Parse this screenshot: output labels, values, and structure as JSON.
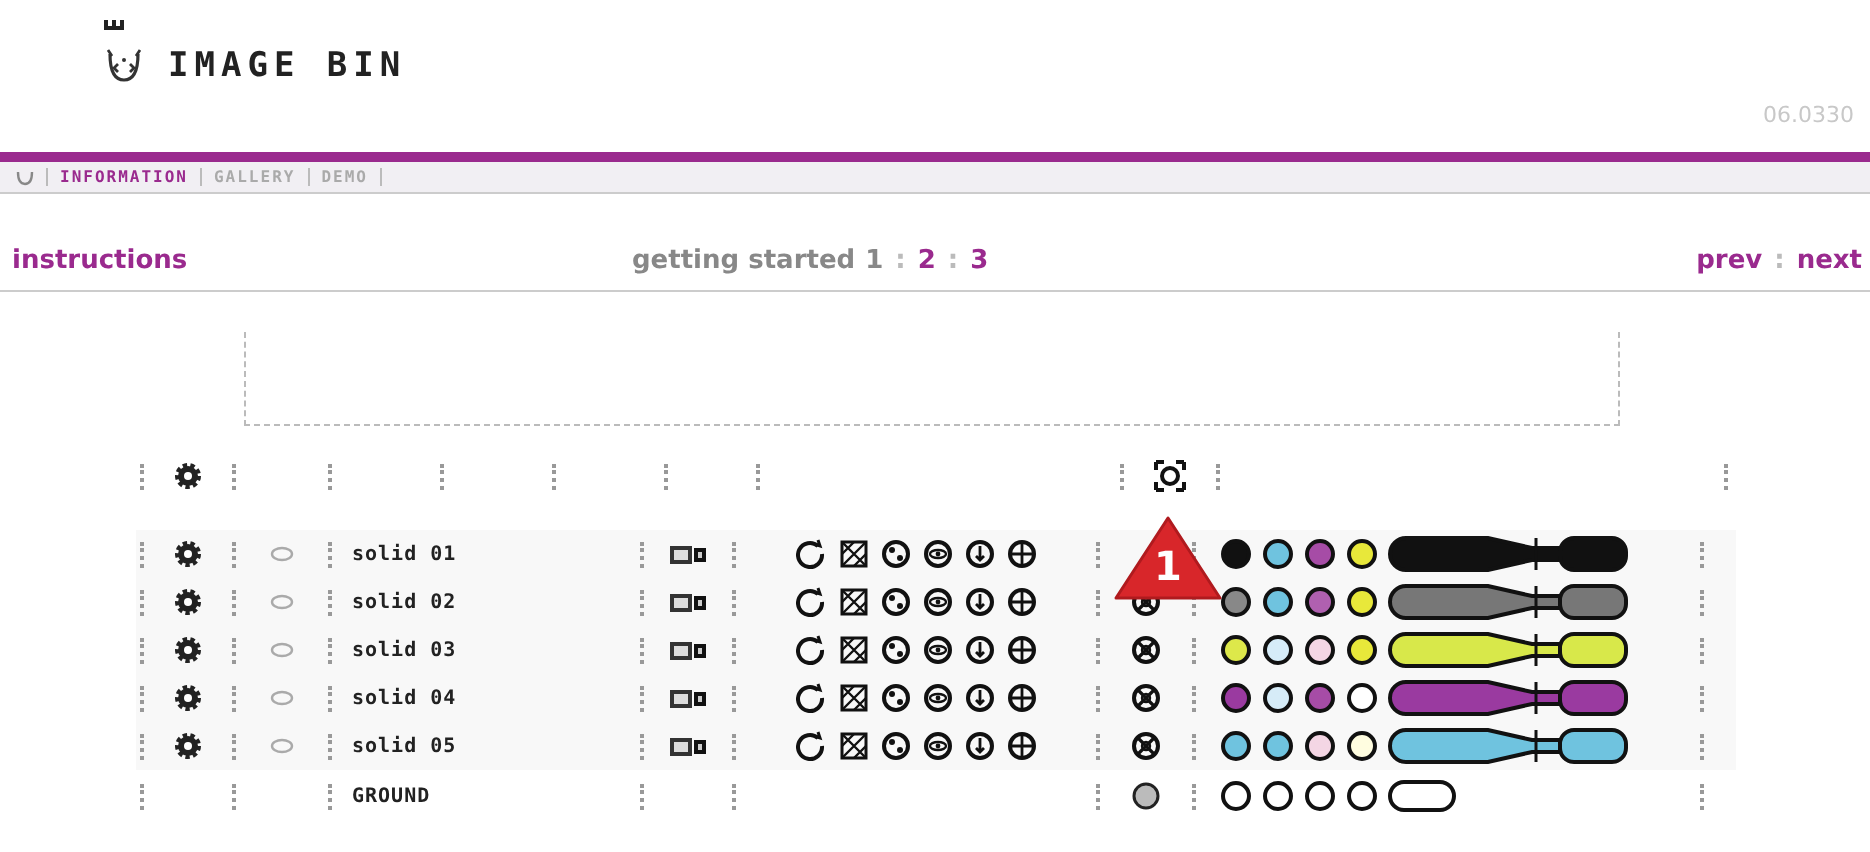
{
  "header": {
    "title": "IMAGE BIN",
    "version": "06.0330"
  },
  "nav": [
    {
      "label": "INFORMATION",
      "selected": true
    },
    {
      "label": "GALLERY",
      "selected": false
    },
    {
      "label": "DEMO",
      "selected": false
    }
  ],
  "subbar": {
    "section": "instructions",
    "intro": "getting started",
    "separators": [
      ":",
      ":"
    ],
    "link_separator": ":",
    "pages": [
      {
        "label": "1",
        "selected": true
      },
      {
        "label": "2",
        "selected": false
      },
      {
        "label": "3",
        "selected": false
      }
    ],
    "prev": "prev",
    "next": "next"
  },
  "badge": {
    "label": "1"
  },
  "rows": [
    {
      "kind": "solid",
      "name": "solid 01",
      "selector_visible": false,
      "swatches": [
        {
          "color": "#111111"
        },
        {
          "color": "#6fc3df"
        },
        {
          "color": "#a64ca6"
        },
        {
          "color": "#e8e83a"
        }
      ],
      "pen": {
        "color": "#111111"
      }
    },
    {
      "kind": "solid",
      "name": "solid 02",
      "selector_visible": true,
      "swatches": [
        {
          "color": "#888888"
        },
        {
          "color": "#6fc3df"
        },
        {
          "color": "#b060b0"
        },
        {
          "color": "#e8e83a"
        }
      ],
      "pen": {
        "color": "#777777"
      }
    },
    {
      "kind": "solid",
      "name": "solid 03",
      "selector_visible": true,
      "swatches": [
        {
          "color": "#dde84a"
        },
        {
          "color": "#d6ecf8"
        },
        {
          "color": "#f4d6e4"
        },
        {
          "color": "#e8e83a"
        }
      ],
      "pen": {
        "color": "#d8e84a"
      }
    },
    {
      "kind": "solid",
      "name": "solid 04",
      "selector_visible": true,
      "swatches": [
        {
          "color": "#9a3aa0"
        },
        {
          "color": "#d6ecf8"
        },
        {
          "color": "#a64ca6"
        },
        {
          "color": "#ffffff"
        }
      ],
      "pen": {
        "color": "#9a3aa0"
      }
    },
    {
      "kind": "solid",
      "name": "solid 05",
      "selector_visible": true,
      "swatches": [
        {
          "color": "#6fc3df"
        },
        {
          "color": "#6fc3df"
        },
        {
          "color": "#f4d6e4"
        },
        {
          "color": "#fffde0"
        }
      ],
      "pen": {
        "color": "#6fc3df"
      }
    },
    {
      "kind": "ground",
      "name": "GROUND",
      "selector_visible": true,
      "swatches": [
        {
          "color": "#ffffff"
        },
        {
          "color": "#ffffff"
        },
        {
          "color": "#ffffff"
        },
        {
          "color": "#ffffff"
        }
      ],
      "pen": {
        "color": "#ffffff"
      }
    }
  ]
}
